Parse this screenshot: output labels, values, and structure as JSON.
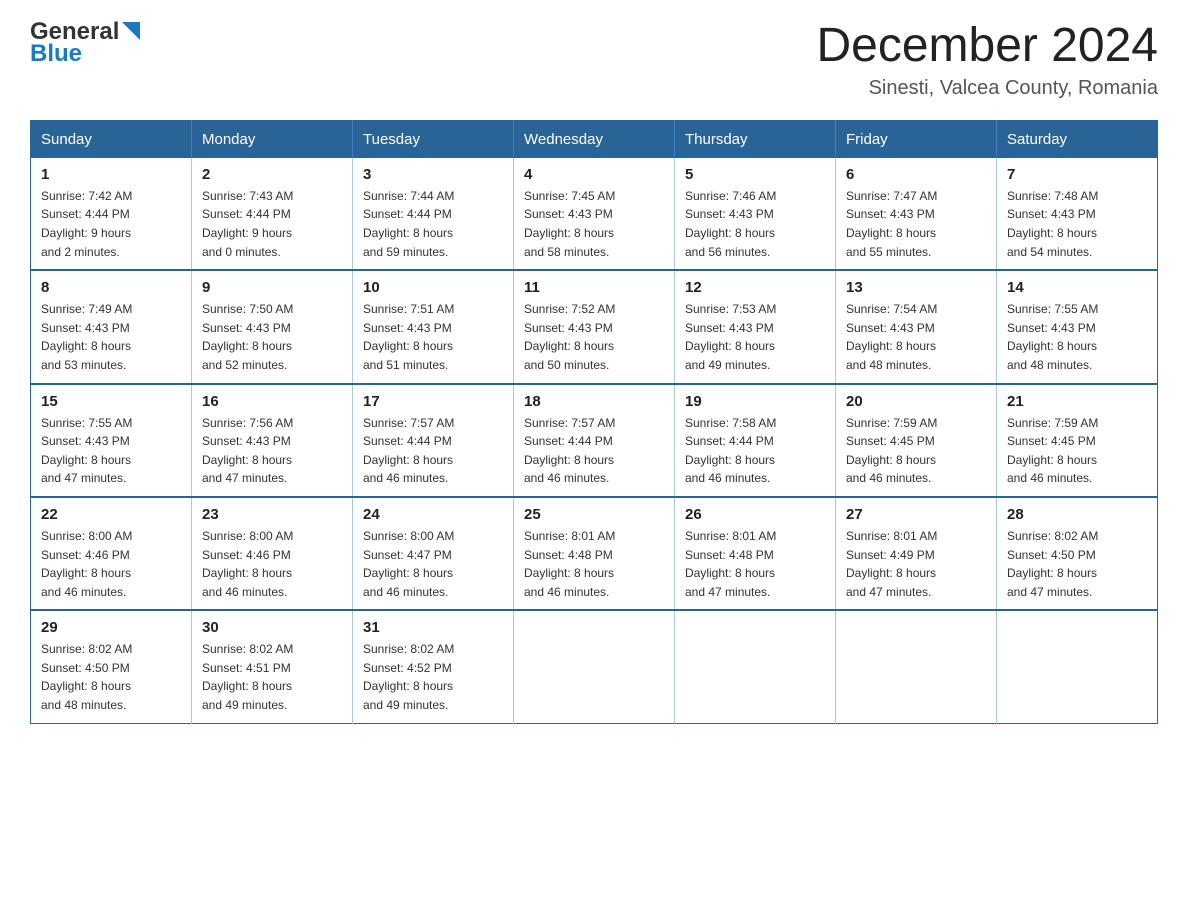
{
  "header": {
    "title": "December 2024",
    "subtitle": "Sinesti, Valcea County, Romania"
  },
  "logo": {
    "general": "General",
    "blue": "Blue"
  },
  "columns": [
    "Sunday",
    "Monday",
    "Tuesday",
    "Wednesday",
    "Thursday",
    "Friday",
    "Saturday"
  ],
  "weeks": [
    [
      {
        "day": "1",
        "sunrise": "7:42 AM",
        "sunset": "4:44 PM",
        "daylight": "9 hours and 2 minutes."
      },
      {
        "day": "2",
        "sunrise": "7:43 AM",
        "sunset": "4:44 PM",
        "daylight": "9 hours and 0 minutes."
      },
      {
        "day": "3",
        "sunrise": "7:44 AM",
        "sunset": "4:44 PM",
        "daylight": "8 hours and 59 minutes."
      },
      {
        "day": "4",
        "sunrise": "7:45 AM",
        "sunset": "4:43 PM",
        "daylight": "8 hours and 58 minutes."
      },
      {
        "day": "5",
        "sunrise": "7:46 AM",
        "sunset": "4:43 PM",
        "daylight": "8 hours and 56 minutes."
      },
      {
        "day": "6",
        "sunrise": "7:47 AM",
        "sunset": "4:43 PM",
        "daylight": "8 hours and 55 minutes."
      },
      {
        "day": "7",
        "sunrise": "7:48 AM",
        "sunset": "4:43 PM",
        "daylight": "8 hours and 54 minutes."
      }
    ],
    [
      {
        "day": "8",
        "sunrise": "7:49 AM",
        "sunset": "4:43 PM",
        "daylight": "8 hours and 53 minutes."
      },
      {
        "day": "9",
        "sunrise": "7:50 AM",
        "sunset": "4:43 PM",
        "daylight": "8 hours and 52 minutes."
      },
      {
        "day": "10",
        "sunrise": "7:51 AM",
        "sunset": "4:43 PM",
        "daylight": "8 hours and 51 minutes."
      },
      {
        "day": "11",
        "sunrise": "7:52 AM",
        "sunset": "4:43 PM",
        "daylight": "8 hours and 50 minutes."
      },
      {
        "day": "12",
        "sunrise": "7:53 AM",
        "sunset": "4:43 PM",
        "daylight": "8 hours and 49 minutes."
      },
      {
        "day": "13",
        "sunrise": "7:54 AM",
        "sunset": "4:43 PM",
        "daylight": "8 hours and 48 minutes."
      },
      {
        "day": "14",
        "sunrise": "7:55 AM",
        "sunset": "4:43 PM",
        "daylight": "8 hours and 48 minutes."
      }
    ],
    [
      {
        "day": "15",
        "sunrise": "7:55 AM",
        "sunset": "4:43 PM",
        "daylight": "8 hours and 47 minutes."
      },
      {
        "day": "16",
        "sunrise": "7:56 AM",
        "sunset": "4:43 PM",
        "daylight": "8 hours and 47 minutes."
      },
      {
        "day": "17",
        "sunrise": "7:57 AM",
        "sunset": "4:44 PM",
        "daylight": "8 hours and 46 minutes."
      },
      {
        "day": "18",
        "sunrise": "7:57 AM",
        "sunset": "4:44 PM",
        "daylight": "8 hours and 46 minutes."
      },
      {
        "day": "19",
        "sunrise": "7:58 AM",
        "sunset": "4:44 PM",
        "daylight": "8 hours and 46 minutes."
      },
      {
        "day": "20",
        "sunrise": "7:59 AM",
        "sunset": "4:45 PM",
        "daylight": "8 hours and 46 minutes."
      },
      {
        "day": "21",
        "sunrise": "7:59 AM",
        "sunset": "4:45 PM",
        "daylight": "8 hours and 46 minutes."
      }
    ],
    [
      {
        "day": "22",
        "sunrise": "8:00 AM",
        "sunset": "4:46 PM",
        "daylight": "8 hours and 46 minutes."
      },
      {
        "day": "23",
        "sunrise": "8:00 AM",
        "sunset": "4:46 PM",
        "daylight": "8 hours and 46 minutes."
      },
      {
        "day": "24",
        "sunrise": "8:00 AM",
        "sunset": "4:47 PM",
        "daylight": "8 hours and 46 minutes."
      },
      {
        "day": "25",
        "sunrise": "8:01 AM",
        "sunset": "4:48 PM",
        "daylight": "8 hours and 46 minutes."
      },
      {
        "day": "26",
        "sunrise": "8:01 AM",
        "sunset": "4:48 PM",
        "daylight": "8 hours and 47 minutes."
      },
      {
        "day": "27",
        "sunrise": "8:01 AM",
        "sunset": "4:49 PM",
        "daylight": "8 hours and 47 minutes."
      },
      {
        "day": "28",
        "sunrise": "8:02 AM",
        "sunset": "4:50 PM",
        "daylight": "8 hours and 47 minutes."
      }
    ],
    [
      {
        "day": "29",
        "sunrise": "8:02 AM",
        "sunset": "4:50 PM",
        "daylight": "8 hours and 48 minutes."
      },
      {
        "day": "30",
        "sunrise": "8:02 AM",
        "sunset": "4:51 PM",
        "daylight": "8 hours and 49 minutes."
      },
      {
        "day": "31",
        "sunrise": "8:02 AM",
        "sunset": "4:52 PM",
        "daylight": "8 hours and 49 minutes."
      },
      null,
      null,
      null,
      null
    ]
  ],
  "labels": {
    "sunrise": "Sunrise:",
    "sunset": "Sunset:",
    "daylight": "Daylight:"
  }
}
